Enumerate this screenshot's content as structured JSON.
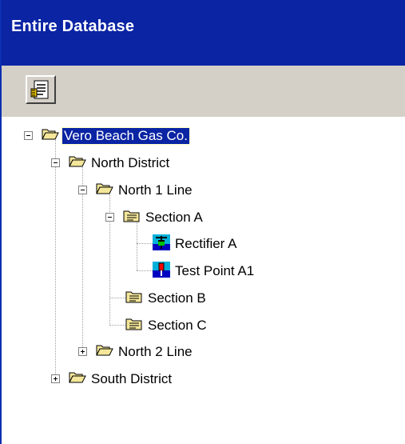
{
  "window": {
    "title": "Entire Database"
  },
  "toolbar": {
    "report_icon": "report-icon"
  },
  "tree": {
    "root": "Vero Beach Gas Co.",
    "north_district": "North District",
    "north_1_line": "North 1 Line",
    "section_a": "Section A",
    "rectifier_a": "Rectifier A",
    "test_point_a1": "Test Point A1",
    "section_b": "Section B",
    "section_c": "Section C",
    "north_2_line": "North 2 Line",
    "south_district": "South District"
  },
  "colors": {
    "title_bg": "#0a24a4",
    "selection": "#0a24a4",
    "folder": "#f5e79a"
  }
}
